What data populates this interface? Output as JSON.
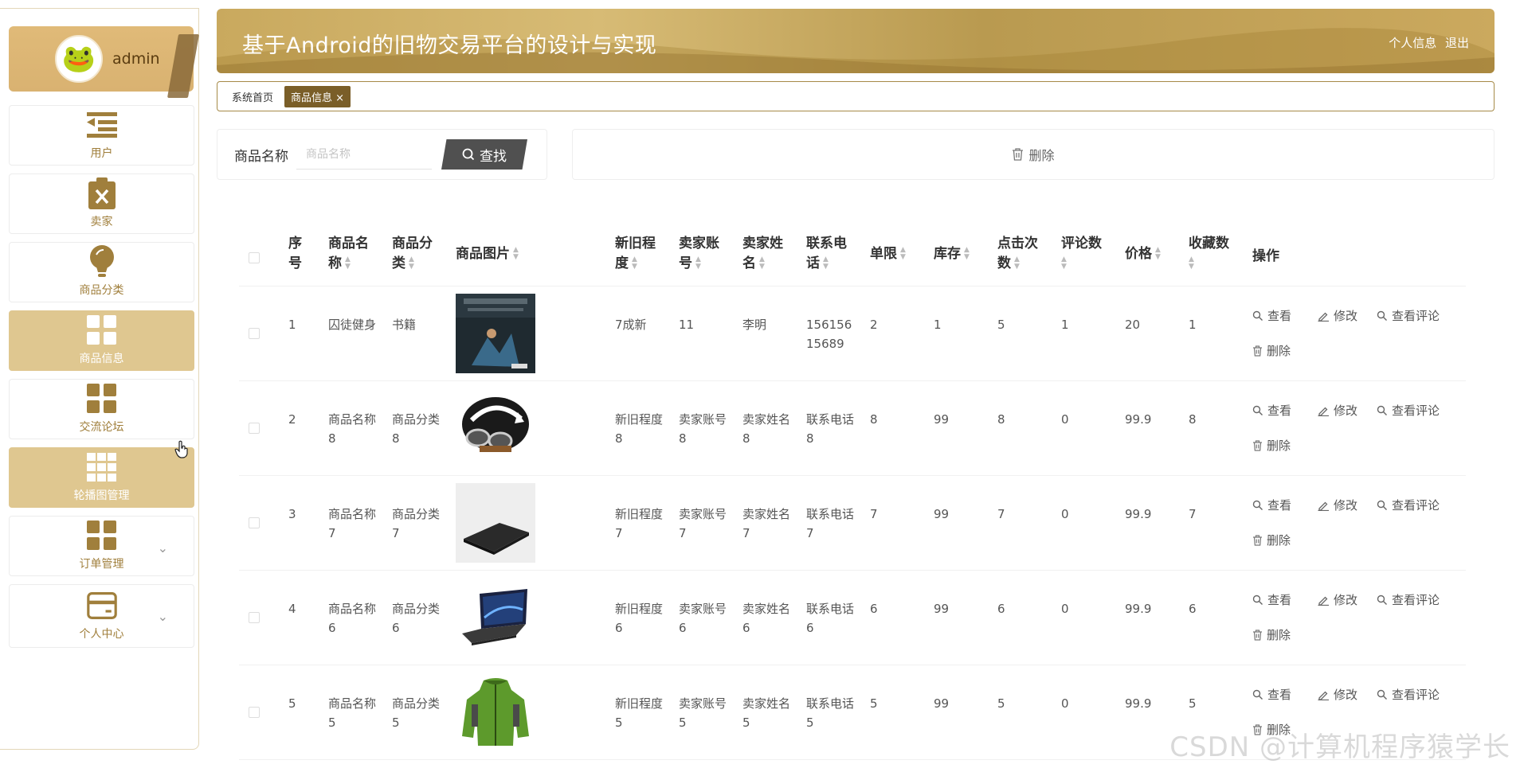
{
  "user": {
    "name": "admin"
  },
  "sidebar": {
    "items": [
      {
        "label": "用户",
        "icon": "list-menu-icon"
      },
      {
        "label": "卖家",
        "icon": "clipboard-x-icon"
      },
      {
        "label": "商品分类",
        "icon": "lightbulb-icon"
      },
      {
        "label": "商品信息",
        "icon": "grid-icon"
      },
      {
        "label": "交流论坛",
        "icon": "grid-icon"
      },
      {
        "label": "轮播图管理",
        "icon": "grid-9-icon"
      },
      {
        "label": "订单管理",
        "icon": "grid-icon"
      },
      {
        "label": "个人中心",
        "icon": "wallet-icon"
      }
    ]
  },
  "header": {
    "title": "基于Android的旧物交易平台的设计与实现",
    "profile_link": "个人信息",
    "logout_link": "退出"
  },
  "tabs": [
    {
      "label": "系统首页"
    },
    {
      "label": "商品信息 ×"
    }
  ],
  "search": {
    "label": "商品名称",
    "placeholder": "商品名称",
    "button": "查找"
  },
  "toolbar": {
    "delete_label": "删除"
  },
  "table": {
    "headers": [
      "序号",
      "商品名称",
      "商品分类",
      "商品图片",
      "新旧程度",
      "卖家账号",
      "卖家姓名",
      "联系电话",
      "单限",
      "库存",
      "点击次数",
      "评论数",
      "价格",
      "收藏数",
      "操作"
    ],
    "ops": {
      "view": "查看",
      "edit": "修改",
      "comments": "查看评论",
      "delete": "删除"
    },
    "rows": [
      {
        "no": "1",
        "name": "囚徒健身",
        "category": "书籍",
        "condition": "7成新",
        "seller_account": "11",
        "seller_name": "李明",
        "phone": "15615615689",
        "limit": "2",
        "stock": "1",
        "clicks": "5",
        "comments": "1",
        "price": "20",
        "favorites": "1"
      },
      {
        "no": "2",
        "name": "商品名称8",
        "category": "商品分类8",
        "condition": "新旧程度8",
        "seller_account": "卖家账号8",
        "seller_name": "卖家姓名8",
        "phone": "联系电话8",
        "limit": "8",
        "stock": "99",
        "clicks": "8",
        "comments": "0",
        "price": "99.9",
        "favorites": "8"
      },
      {
        "no": "3",
        "name": "商品名称7",
        "category": "商品分类7",
        "condition": "新旧程度7",
        "seller_account": "卖家账号7",
        "seller_name": "卖家姓名7",
        "phone": "联系电话7",
        "limit": "7",
        "stock": "99",
        "clicks": "7",
        "comments": "0",
        "price": "99.9",
        "favorites": "7"
      },
      {
        "no": "4",
        "name": "商品名称6",
        "category": "商品分类6",
        "condition": "新旧程度6",
        "seller_account": "卖家账号6",
        "seller_name": "卖家姓名6",
        "phone": "联系电话6",
        "limit": "6",
        "stock": "99",
        "clicks": "6",
        "comments": "0",
        "price": "99.9",
        "favorites": "6"
      },
      {
        "no": "5",
        "name": "商品名称5",
        "category": "商品分类5",
        "condition": "新旧程度5",
        "seller_account": "卖家账号5",
        "seller_name": "卖家姓名5",
        "phone": "联系电话5",
        "limit": "5",
        "stock": "99",
        "clicks": "5",
        "comments": "0",
        "price": "99.9",
        "favorites": "5"
      }
    ]
  },
  "watermark": "CSDN @计算机程序猿学长",
  "colors": {
    "accent": "#c9a95e",
    "active_menu": "#dfc790",
    "active_tab": "#7a5e28",
    "button_dark": "#505050"
  }
}
